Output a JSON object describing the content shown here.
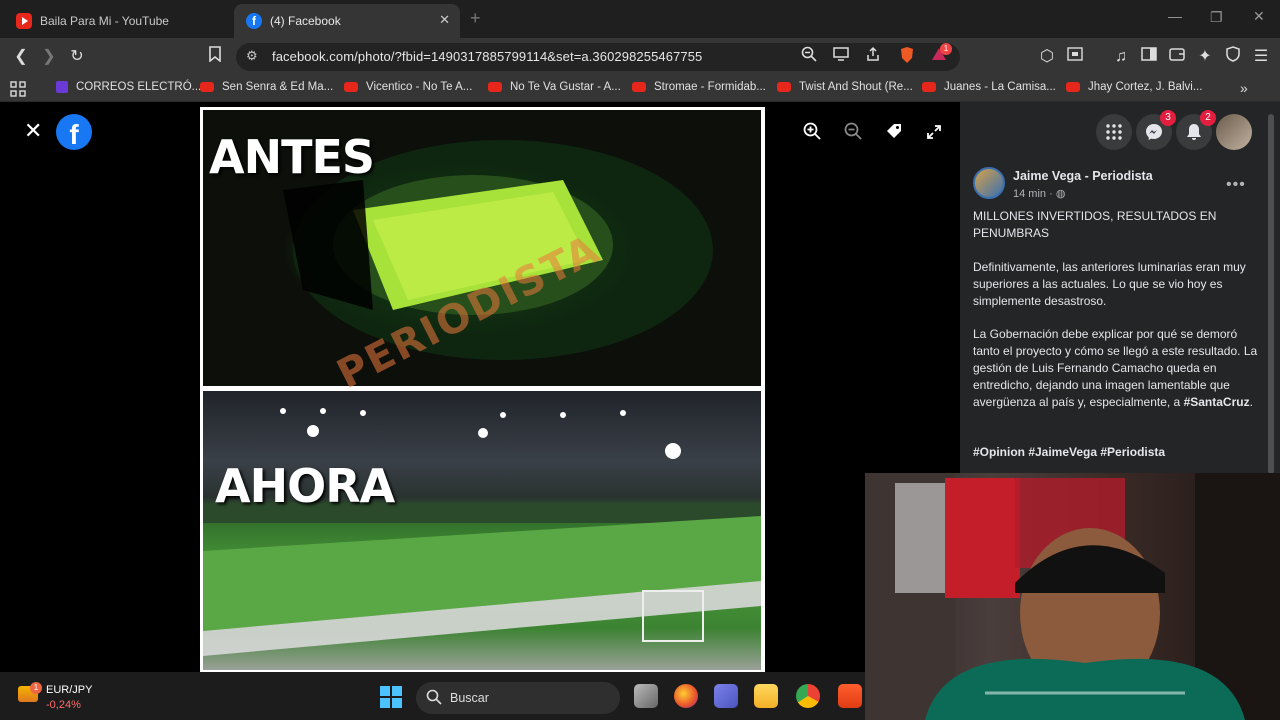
{
  "browser": {
    "tabs": [
      {
        "title": "Baila Para Mi - YouTube",
        "active": false
      },
      {
        "title": "(4) Facebook",
        "active": true
      }
    ],
    "url": "facebook.com/photo/?fbid=1490317885799114&set=a.360298255467755",
    "shield_count": "1",
    "bookmarks": [
      "CORREOS ELECTRÓ...",
      "Sen Senra & Ed Ma...",
      "Vicentico - No Te A...",
      "No Te Va Gustar - A...",
      "Stromae - Formidab...",
      "Twist And Shout (Re...",
      "Juanes - La Camisa...",
      "Jhay Cortez, J. Balvi..."
    ]
  },
  "photo": {
    "top_label": "ANTES",
    "bottom_label": "AHORA",
    "watermark": "PERIODISTA"
  },
  "panel": {
    "messenger_badge": "3",
    "notifications_badge": "2",
    "author": "Jaime Vega - Periodista",
    "time": "14 min ·",
    "headline": "MILLONES INVERTIDOS, RESULTADOS EN PENUMBRAS",
    "paragraph1": "Definitivamente, las anteriores luminarias eran muy superiores a las actuales. Lo que se vio hoy es simplemente desastroso.",
    "paragraph2": "La Gobernación debe explicar por qué se demoró tanto el proyecto y cómo se llegó a este resultado. La gestión de Luis Fernando Camacho queda en entredicho, dejando una imagen lamentable que avergüenza al país y, especialmente, a",
    "paragraph2_tag": "#SantaCruz",
    "paragraph2_end": ".",
    "hashtags": "#Opinion #JaimeVega #Periodista"
  },
  "taskbar": {
    "ticker_symbol": "EUR/JPY",
    "ticker_change": "-0,24%",
    "ticker_badge": "1",
    "search_placeholder": "Buscar"
  }
}
